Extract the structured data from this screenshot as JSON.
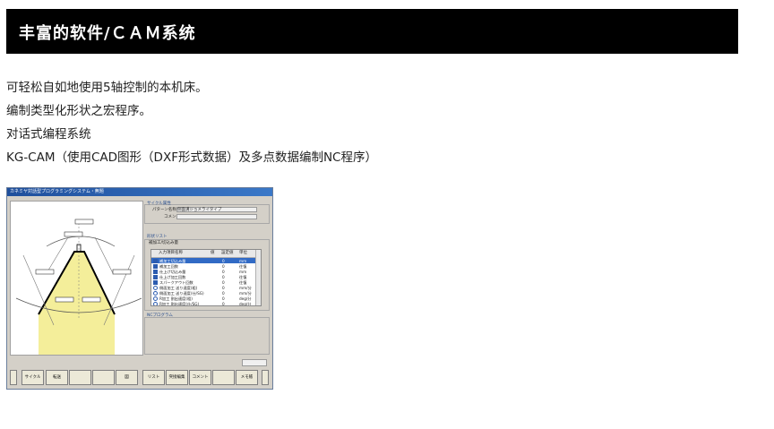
{
  "header": {
    "title": "丰富的软件/ＣＡＭ系统"
  },
  "paragraphs": [
    "可轻松自如地使用5轴控制的本机床。",
    "编制类型化形状之宏程序。",
    "对话式编程系统",
    "KG-CAM（使用CAD图形（DXF形式数据）及多点数据编制NC程序）"
  ],
  "window": {
    "title": "カネミヤ対話型プログラミングシステム・無題",
    "cycle_group": "サイクル属性",
    "pattern_label": "パターン名称",
    "pattern_value": "側面溝ジョメライタイプ",
    "comment_label": "コメント",
    "shape_list_group": "形状リスト",
    "tab_label": "補加工/切込み量",
    "columns": [
      "入力項目名称",
      "値",
      "設定値",
      "単位"
    ],
    "rows": [
      {
        "name": "補加工切込み量",
        "value": "0",
        "unit": "mm",
        "icon": "square",
        "selected": true
      },
      {
        "name": "補加工回数",
        "value": "0",
        "unit": "往復",
        "icon": "square"
      },
      {
        "name": "仕上げ切込み量",
        "value": "0",
        "unit": "mm",
        "icon": "square"
      },
      {
        "name": "仕上げ加工回数",
        "value": "0",
        "unit": "往復",
        "icon": "square"
      },
      {
        "name": "スパークアウト回数",
        "value": "0",
        "unit": "往復",
        "icon": "square"
      },
      {
        "name": "側面加工 送り速度(粗)",
        "value": "0",
        "unit": "mm/分",
        "icon": "circle"
      },
      {
        "name": "側面加工 送り速度(仕/SG)",
        "value": "0",
        "unit": "mm/分",
        "icon": "circle"
      },
      {
        "name": "R加工 割出速度(粗)",
        "value": "0",
        "unit": "deg/分",
        "icon": "circle"
      },
      {
        "name": "R加工 割出速度(仕/SG)",
        "value": "0",
        "unit": "deg/分",
        "icon": "circle"
      }
    ],
    "nc_group": "NCプログラム",
    "buttons": [
      "",
      "サイクル",
      "転送",
      "",
      "",
      "図",
      "",
      "リスト",
      "突接編集",
      "コメント",
      "",
      "メモ帳",
      ""
    ]
  },
  "colors": {
    "header_bg": "#000000",
    "titlebar": "#1f4f9c",
    "shape_fill": "#f4ee9a",
    "list_selected": "#316ac5"
  }
}
